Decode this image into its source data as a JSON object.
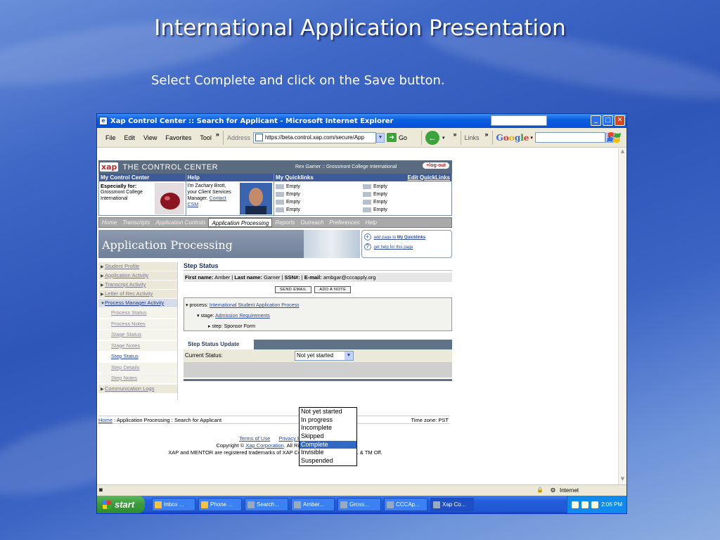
{
  "slide": {
    "title": "International Application Presentation",
    "subtitle": "Select Complete and click on the Save button."
  },
  "window": {
    "title": "Xap Control Center :: Search for Applicant - Microsoft Internet Explorer",
    "buttons": [
      "_",
      "□",
      "✕"
    ]
  },
  "toolbar": {
    "menu": [
      "File",
      "Edit",
      "View",
      "Favorites",
      "Tool"
    ],
    "address_label": "Address",
    "address_value": "https://beta.control.xap.com/secure/App",
    "go_label": "Go",
    "links_label": "Links",
    "google_label": "Google"
  },
  "site": {
    "logo": "xap",
    "brand": "THE CONTROL CENTER",
    "user_info": "Rex Garner :: Grossmont College International",
    "logout": "+log-out",
    "panels": {
      "my_control_center": {
        "header": "My Control Center",
        "heading": "Especially for:",
        "text": "Grossmont College International"
      },
      "help": {
        "header": "Help",
        "text": "I'm Zachary Brott, your Client Services Manager.",
        "link1": "Contact",
        "link2": "CSM"
      },
      "quicklinks": {
        "header": "My Quicklinks",
        "edit": "Edit QuickLinks",
        "items": [
          "Empty",
          "Empty",
          "Empty",
          "Empty",
          "Empty",
          "Empty",
          "Empty",
          "Empty"
        ]
      }
    },
    "nav": [
      "Home",
      "Transcripts",
      "Application Controls",
      "Application Processing",
      "Reports",
      "Outreach",
      "Preferences",
      "Help"
    ],
    "banner_title": "Application Processing",
    "banner_links": {
      "add": "add page to ",
      "add_bold": "My Quicklinks",
      "help": "get help for this page"
    },
    "leftnav": {
      "items": [
        "Student Profile",
        "Application Activity",
        "Transcript Activity",
        "Letter of Rec Activity",
        "Process Manager Activity"
      ],
      "subs": [
        "Process Status",
        "Process Notes",
        "Stage Status",
        "Stage Notes",
        "Step Status",
        "Step Details",
        "Step Notes"
      ],
      "last": "Communication Logs"
    },
    "step": {
      "title": "Step Status",
      "first_name_label": "First name:",
      "first_name": "Amber",
      "last_name_label": "Last name:",
      "last_name": "Garner",
      "ssn_label": "SSN#:",
      "email_label": "E-mail:",
      "email": "ambgar@cccapply.org",
      "send_email": "SEND EMAIL",
      "add_note": "ADD A NOTE",
      "process_label": "process:",
      "process_value": "International Student Application Process",
      "stage_label": "stage:",
      "stage_value": "Admission Requirements",
      "step_label": "step:",
      "step_value": "Sponsor Form"
    },
    "update": {
      "tab": "Step Status Update",
      "current_status_label": "Current Status:",
      "current_status_value": "Not yet started",
      "options": [
        "Not yet started",
        "In progress",
        "Incomplete",
        "Skipped",
        "Complete",
        "Invisible",
        "Suspended"
      ],
      "highlighted": "Complete"
    },
    "footer": {
      "home": "Home",
      "path": " : Application Processing : Search for Applicant",
      "timezone": "Time zone: PST",
      "terms": "Terms of Use",
      "privacy": "Privacy Policy",
      "copyright_pre": "Copyright © ",
      "copyright_link": "Xap Corporation",
      "copyright_post": ". All Rights Reserved.",
      "trademark": "XAP and MENTOR are registered trademarks of XAP Corporation. Reg. U.S. Pat. & TM Off."
    }
  },
  "statusbar": {
    "zone": "Internet"
  },
  "taskbar": {
    "start": "start",
    "tasks": [
      "Inbox ...",
      "Phone ...",
      "Search...",
      "Amber...",
      "Gross...",
      "CCCAp...",
      "Xap Co..."
    ],
    "clock": "2:06 PM"
  }
}
